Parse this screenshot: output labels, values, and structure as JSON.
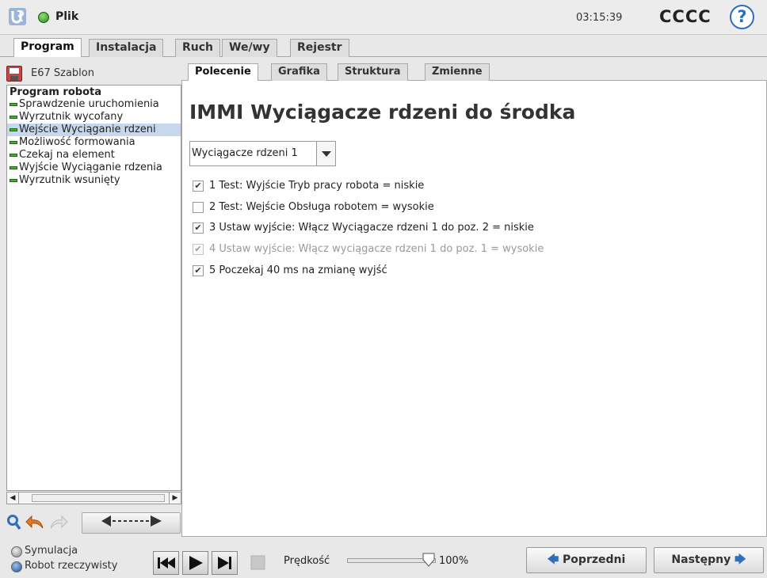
{
  "header": {
    "file_menu": "Plik",
    "clock": "03:15:39",
    "robot_name": "CCCC",
    "help_label": "?"
  },
  "main_tabs": [
    {
      "label": "Program",
      "active": true
    },
    {
      "label": "Instalacja"
    },
    {
      "label": "Ruch"
    },
    {
      "label": "We/wy"
    },
    {
      "label": "Rejestr"
    }
  ],
  "left": {
    "file_name": "E67 Szablon",
    "tree_root": "Program robota",
    "tree_items": [
      "Sprawdzenie uruchomienia",
      "Wyrzutnik wycofany",
      "Wejście Wyciąganie rdzeni",
      "Możliwość formowania",
      "Czekaj na element",
      "Wyjście Wyciąganie rdzenia",
      "Wyrzutnik wsunięty"
    ],
    "selected_index": 2
  },
  "sub_tabs": [
    {
      "label": "Polecenie",
      "active": true
    },
    {
      "label": "Grafika"
    },
    {
      "label": "Struktura"
    },
    {
      "label": "Zmienne"
    }
  ],
  "content": {
    "title": "IMMI Wyciągacze rdzeni do środka",
    "dropdown_value": "Wyciągacze rdzeni 1",
    "conditions": [
      {
        "text": "1 Test: Wyjście Tryb pracy robota = niskie",
        "checked": true,
        "enabled": true
      },
      {
        "text": "2 Test: Wejście Obsługa robotem = wysokie",
        "checked": false,
        "enabled": true
      },
      {
        "text": "3 Ustaw wyjście: Włącz Wyciągacze rdzeni 1 do poz. 2 = niskie",
        "checked": true,
        "enabled": true
      },
      {
        "text": "4 Ustaw wyjście: Włącz wyciągacze rdzeni 1 do poz. 1 = wysokie",
        "checked": true,
        "enabled": false
      },
      {
        "text": "5 Poczekaj 40 ms na zmianę wyjść",
        "checked": true,
        "enabled": true
      }
    ]
  },
  "bottom": {
    "mode_simulation": "Symulacja",
    "mode_real": "Robot rzeczywisty",
    "speed_label": "Prędkość",
    "speed_value": "100%",
    "speed_fraction": 1.0,
    "prev_label": "Poprzedni",
    "next_label": "Następny"
  },
  "colors": {
    "accent_blue": "#2f6fb7",
    "tree_marker_green": "#3ab52a",
    "selection": "#c7d8ee"
  }
}
